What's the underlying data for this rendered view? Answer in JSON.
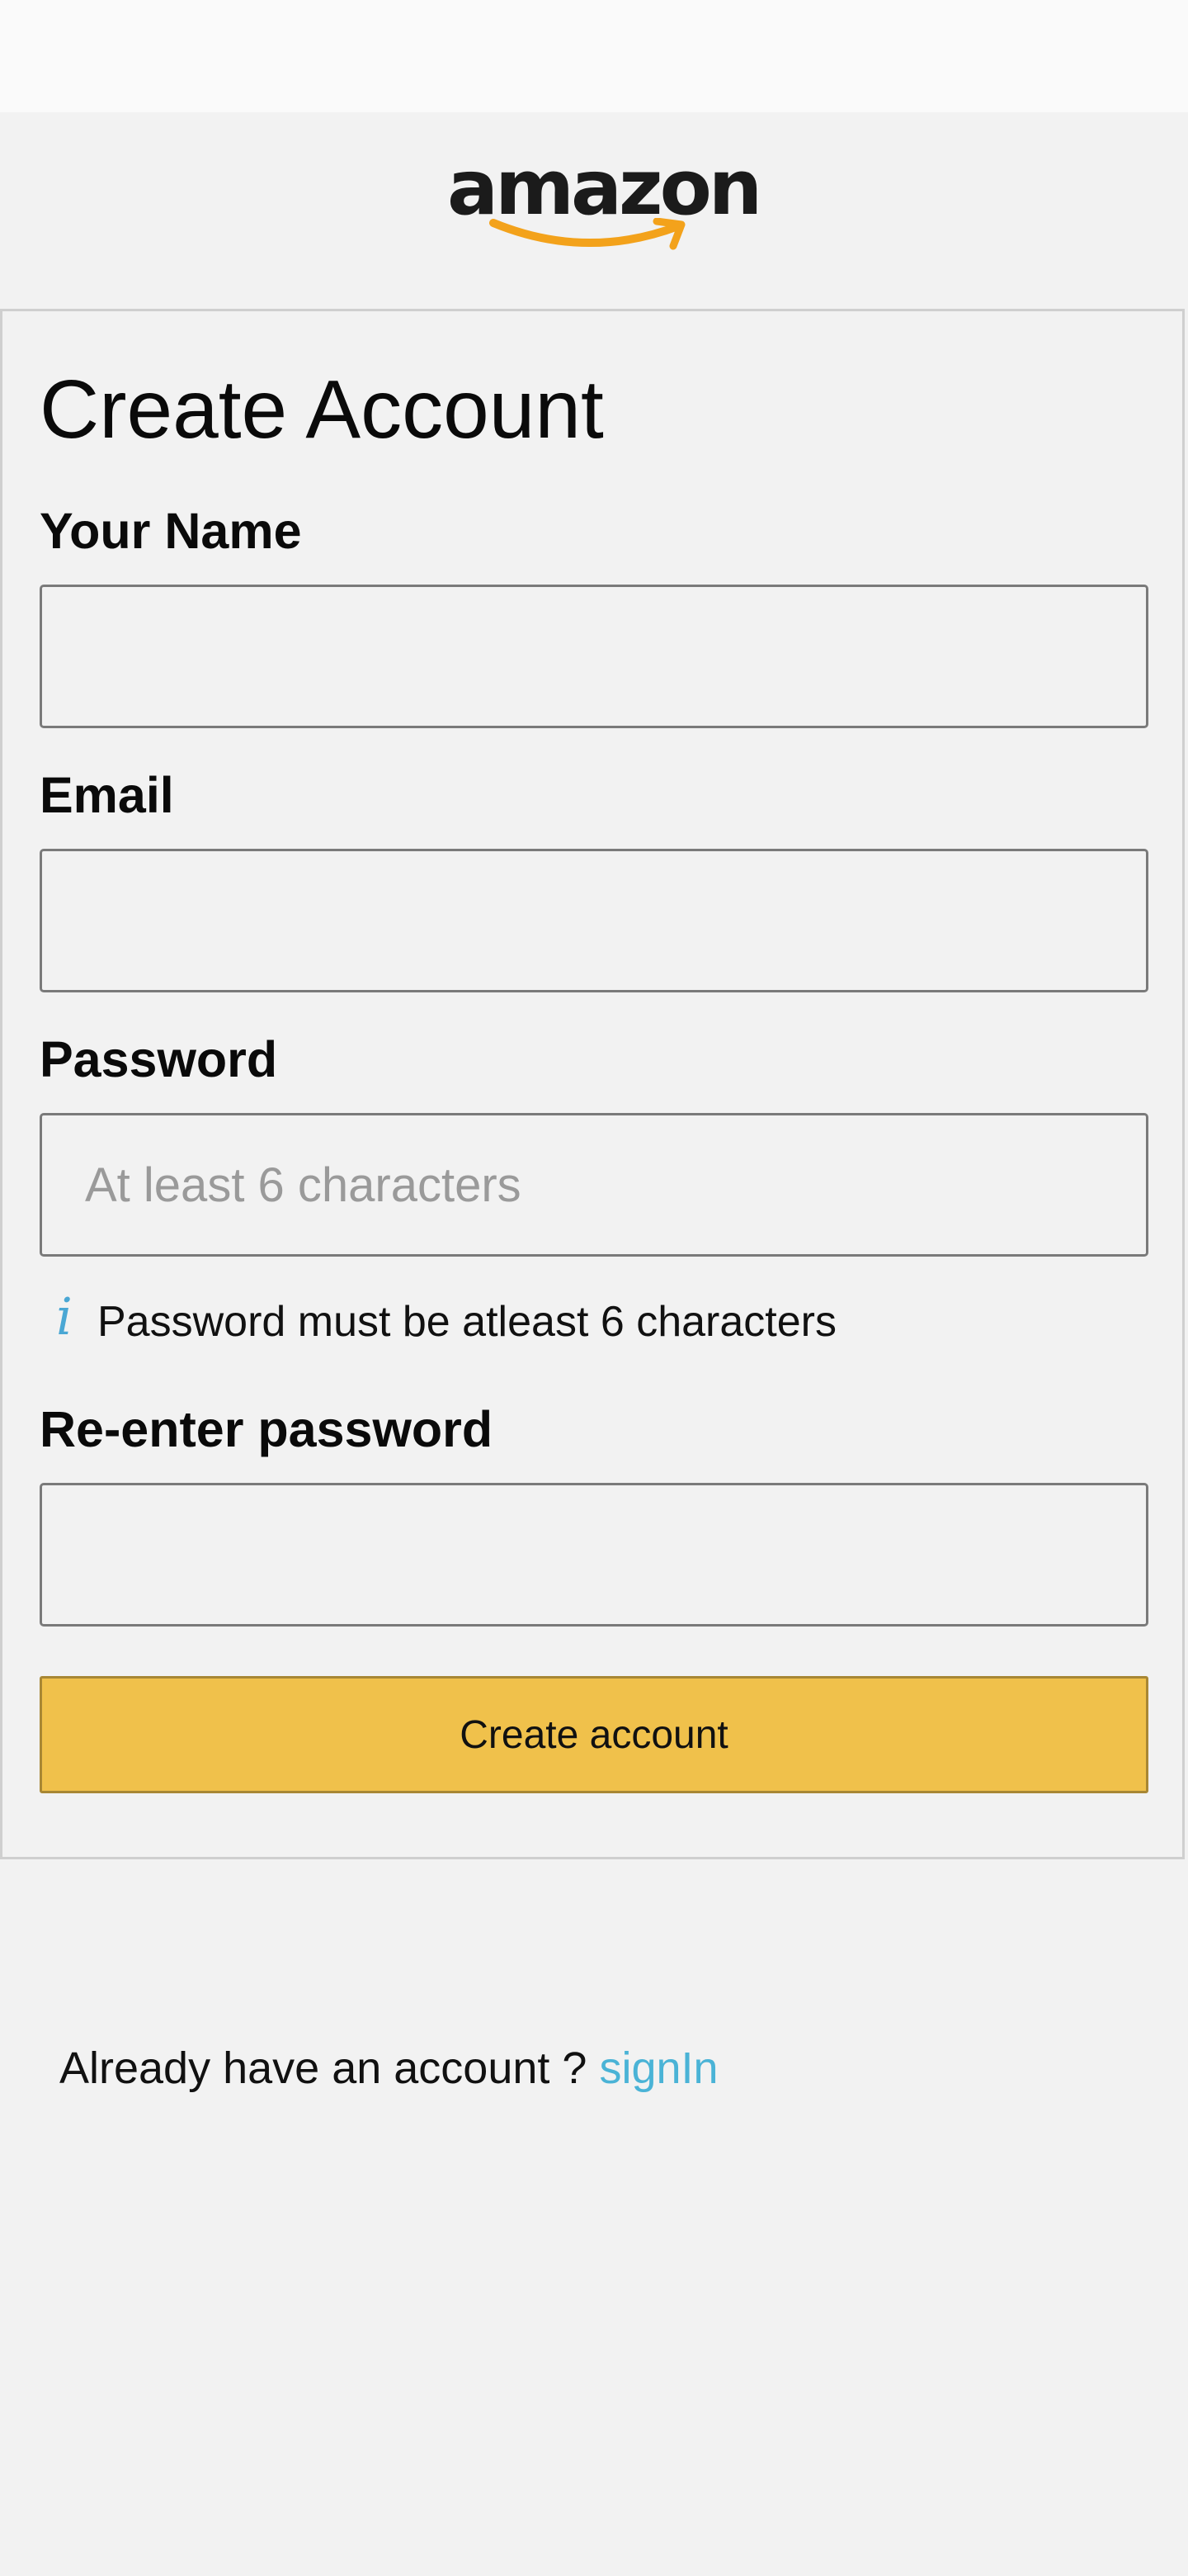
{
  "logo": {
    "text": "amazon",
    "icon": "amazon-smile-arrow-icon",
    "arrow_color": "#f3a21b"
  },
  "form": {
    "title": "Create Account",
    "name_label": "Your Name",
    "email_label": "Email",
    "password_label": "Password",
    "password_placeholder": "At least 6 characters",
    "password_hint_icon": "info-icon",
    "password_hint": "Password must be atleast 6 characters",
    "reenter_label": "Re-enter password",
    "submit_label": "Create account",
    "button_color": "#f0c14b"
  },
  "footer": {
    "prompt": "Already have an account ?",
    "signin_label": "signIn",
    "link_color": "#4ab3d6"
  }
}
